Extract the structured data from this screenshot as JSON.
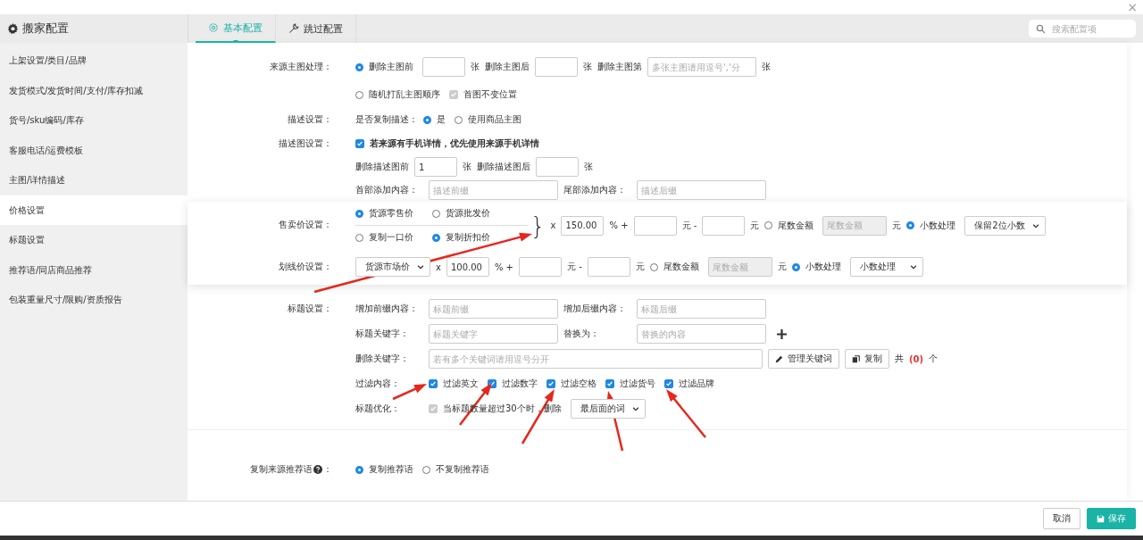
{
  "window": {
    "title": "搬家配置",
    "close": "×"
  },
  "tabs": [
    {
      "label": "基本配置",
      "selected": true
    },
    {
      "label": "跳过配置",
      "selected": false
    }
  ],
  "search": {
    "placeholder": "搜索配置项"
  },
  "sidebar": {
    "items": [
      {
        "label": "上架设置/类目/品牌",
        "selected": false
      },
      {
        "label": "发货模式/发货时间/支付/库存扣减",
        "selected": false
      },
      {
        "label": "货号/sku编码/库存",
        "selected": false
      },
      {
        "label": "客服电话/运费模板",
        "selected": false
      },
      {
        "label": "主图/详情描述",
        "selected": false
      },
      {
        "label": "价格设置",
        "selected": true
      },
      {
        "label": "标题设置",
        "selected": false
      },
      {
        "label": "推荐语/同店商品推荐",
        "selected": false
      },
      {
        "label": "包装重量尺寸/限购/资质报告",
        "selected": false
      }
    ]
  },
  "groups": [
    {
      "kind": "plain",
      "sections": [
        {
          "label": "来源主图处理：",
          "lines": [
            [
              {
                "kind": "radio",
                "label": "删除主图前",
                "selected": true
              },
              {
                "kind": "num"
              },
              {
                "kind": "text",
                "text": "张"
              },
              {
                "kind": "text",
                "text": "删除主图后"
              },
              {
                "kind": "num"
              },
              {
                "kind": "text",
                "text": "张"
              },
              {
                "kind": "text",
                "text": "删除主图第"
              },
              {
                "kind": "mid",
                "placeholder": "多张主图请用逗号','分"
              },
              {
                "kind": "text",
                "text": "张"
              }
            ],
            [
              {
                "kind": "radio",
                "label": "随机打乱主图顺序",
                "selected": false
              },
              {
                "kind": "checkbox",
                "label": "首图不变位置",
                "checked": true,
                "disabled": true
              }
            ]
          ]
        },
        {
          "label": "描述设置：",
          "lines": [
            [
              {
                "kind": "text",
                "text": "是否复制描述："
              },
              {
                "kind": "radio",
                "label": "是",
                "selected": true
              },
              {
                "kind": "radio",
                "label": "使用商品主图",
                "selected": false
              }
            ]
          ]
        },
        {
          "label": "描述图设置：",
          "lines": [
            [
              {
                "kind": "checkbox",
                "label": "若来源有手机详情，优先使用来源手机详情",
                "checked": true,
                "bold": true
              }
            ],
            [
              {
                "kind": "text",
                "text": "删除描述图前"
              },
              {
                "kind": "num",
                "value": "1"
              },
              {
                "kind": "text",
                "text": "张"
              },
              {
                "kind": "text",
                "text": "删除描述图后"
              },
              {
                "kind": "num"
              },
              {
                "kind": "text",
                "text": "张"
              }
            ],
            [
              {
                "kind": "field_label",
                "text": "首部添加内容："
              },
              {
                "kind": "field",
                "placeholder": "描述前缀"
              },
              {
                "kind": "field_label",
                "text": "尾部添加内容："
              },
              {
                "kind": "field",
                "placeholder": "描述后缀"
              }
            ]
          ]
        }
      ]
    },
    {
      "kind": "card",
      "sections": [
        {
          "label": "售卖价设置：",
          "lines": [
            [
              {
                "kind": "choice_grid",
                "rows": [
                  [
                    {
                      "label": "货源零售价",
                      "selected": true
                    },
                    {
                      "label": "货源批发价",
                      "selected": false
                    }
                  ],
                  [
                    {
                      "label": "复制一口价",
                      "selected": false
                    },
                    {
                      "label": "复制折扣价",
                      "selected": true
                    }
                  ]
                ]
              },
              {
                "kind": "brace",
                "text": "}"
              },
              {
                "kind": "text",
                "text": "x"
              },
              {
                "kind": "num",
                "value": "150.00"
              },
              {
                "kind": "text",
                "text": "% +"
              },
              {
                "kind": "num"
              },
              {
                "kind": "text",
                "text": "元 -"
              },
              {
                "kind": "num"
              },
              {
                "kind": "text",
                "text": "元"
              },
              {
                "kind": "radio",
                "label": "尾数金额",
                "selected": false
              },
              {
                "kind": "short",
                "placeholder": "尾数金额",
                "disabled": true
              },
              {
                "kind": "text",
                "text": "元"
              },
              {
                "kind": "radio",
                "label": "小数处理",
                "selected": true
              },
              {
                "kind": "select",
                "value": "保留2位小数"
              }
            ]
          ]
        },
        {
          "label": "划线价设置：",
          "lines": [
            [
              {
                "kind": "select",
                "value": "货源市场价"
              },
              {
                "kind": "text",
                "text": "x"
              },
              {
                "kind": "num",
                "value": "100.00"
              },
              {
                "kind": "text",
                "text": "% +"
              },
              {
                "kind": "num"
              },
              {
                "kind": "text",
                "text": "元 -"
              },
              {
                "kind": "num"
              },
              {
                "kind": "text",
                "text": "元"
              },
              {
                "kind": "radio",
                "label": "尾数金额",
                "selected": false
              },
              {
                "kind": "short",
                "placeholder": "尾数金额",
                "disabled": true
              },
              {
                "kind": "text",
                "text": "元"
              },
              {
                "kind": "radio",
                "label": "小数处理",
                "selected": true
              },
              {
                "kind": "select",
                "value": "小数处理"
              }
            ]
          ]
        }
      ]
    },
    {
      "kind": "plain",
      "sections": [
        {
          "label": "标题设置：",
          "lines": [
            [
              {
                "kind": "field_label",
                "text": "增加前缀内容："
              },
              {
                "kind": "field",
                "placeholder": "标题前缀"
              },
              {
                "kind": "field_label",
                "text": "增加后缀内容："
              },
              {
                "kind": "field",
                "placeholder": "标题后缀"
              }
            ],
            [
              {
                "kind": "field_label",
                "text": "标题关键字："
              },
              {
                "kind": "field",
                "placeholder": "标题关键字"
              },
              {
                "kind": "field_label",
                "text": "替换为："
              },
              {
                "kind": "field",
                "placeholder": "替换的内容"
              },
              {
                "kind": "plus"
              }
            ],
            [
              {
                "kind": "field_label",
                "text": "删除关键字："
              },
              {
                "kind": "wide",
                "placeholder": "若有多个关键词请用逗号分开"
              },
              {
                "kind": "edit_button",
                "label": "管理关键词"
              },
              {
                "kind": "copy_button",
                "label": "复制"
              },
              {
                "kind": "text",
                "text": "共"
              },
              {
                "kind": "count",
                "text": "(0)"
              },
              {
                "kind": "text",
                "text": "个"
              }
            ],
            [
              {
                "kind": "field_label",
                "text": "过滤内容："
              },
              {
                "kind": "checkbox",
                "label": "过滤英文",
                "checked": true
              },
              {
                "kind": "checkbox",
                "label": "过滤数字",
                "checked": true
              },
              {
                "kind": "checkbox",
                "label": "过滤空格",
                "checked": true
              },
              {
                "kind": "checkbox",
                "label": "过滤货号",
                "checked": true
              },
              {
                "kind": "checkbox",
                "label": "过滤品牌",
                "checked": true
              }
            ],
            [
              {
                "kind": "field_label",
                "text": "标题优化："
              },
              {
                "kind": "checkbox",
                "label": "当标题数量超过30个时，删除",
                "checked": true,
                "disabled": true
              },
              {
                "kind": "select",
                "value": "最后面的词"
              }
            ]
          ]
        }
      ]
    },
    {
      "kind": "plain",
      "sections": [
        {
          "label": "复制来源推荐语",
          "help": true,
          "label_end": "：",
          "lines": [
            [
              {
                "kind": "radio",
                "label": "复制推荐语",
                "selected": true
              },
              {
                "kind": "radio",
                "label": "不复制推荐语",
                "selected": false
              }
            ]
          ]
        }
      ]
    }
  ],
  "footer": {
    "buttons": [
      {
        "label": "取消",
        "kind": "cancel"
      },
      {
        "label": "保存",
        "kind": "save"
      }
    ]
  }
}
